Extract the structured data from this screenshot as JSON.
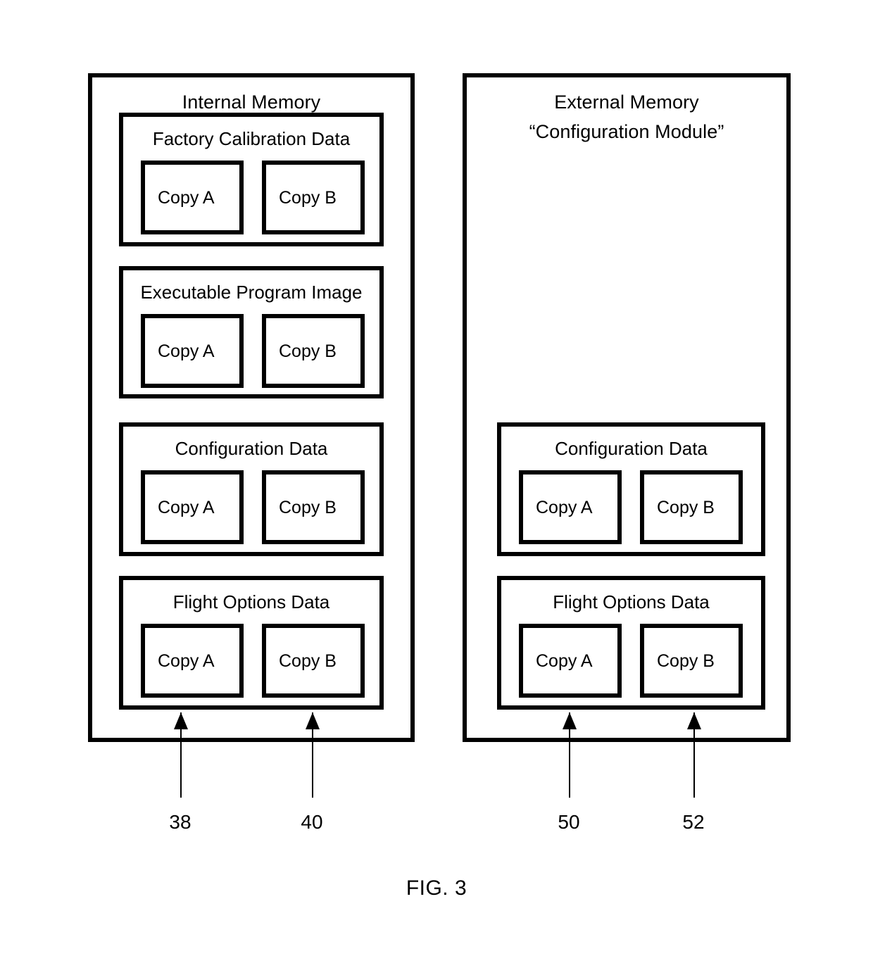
{
  "figure": {
    "caption": "FIG. 3"
  },
  "panels": [
    {
      "id": "internal-memory",
      "title": "Internal Memory",
      "subtitle": "",
      "sections": [
        {
          "id": "factory-calibration",
          "title": "Factory Calibration Data",
          "copies": [
            {
              "id": "copy-a",
              "label": "Copy A"
            },
            {
              "id": "copy-b",
              "label": "Copy B"
            }
          ]
        },
        {
          "id": "executable-program",
          "title": "Executable Program Image",
          "copies": [
            {
              "id": "copy-a",
              "label": "Copy A"
            },
            {
              "id": "copy-b",
              "label": "Copy B"
            }
          ]
        },
        {
          "id": "configuration-data",
          "title": "Configuration Data",
          "copies": [
            {
              "id": "copy-a",
              "label": "Copy A"
            },
            {
              "id": "copy-b",
              "label": "Copy B"
            }
          ]
        },
        {
          "id": "flight-options",
          "title": "Flight Options Data",
          "copies": [
            {
              "id": "copy-a",
              "label": "Copy A"
            },
            {
              "id": "copy-b",
              "label": "Copy B"
            }
          ]
        }
      ]
    },
    {
      "id": "external-memory",
      "title": "External Memory",
      "subtitle": "“Configuration Module”",
      "sections": [
        {
          "id": "configuration-data",
          "title": "Configuration Data",
          "copies": [
            {
              "id": "copy-a",
              "label": "Copy A"
            },
            {
              "id": "copy-b",
              "label": "Copy B"
            }
          ]
        },
        {
          "id": "flight-options",
          "title": "Flight Options Data",
          "copies": [
            {
              "id": "copy-a",
              "label": "Copy A"
            },
            {
              "id": "copy-b",
              "label": "Copy B"
            }
          ]
        }
      ]
    }
  ],
  "callouts": [
    {
      "id": "callout-38",
      "number": "38",
      "points_to": "internal-memory.flight-options.copy-a"
    },
    {
      "id": "callout-40",
      "number": "40",
      "points_to": "internal-memory.flight-options.copy-b"
    },
    {
      "id": "callout-50",
      "number": "50",
      "points_to": "external-memory.flight-options.copy-a"
    },
    {
      "id": "callout-52",
      "number": "52",
      "points_to": "external-memory.flight-options.copy-b"
    }
  ],
  "style": {
    "stroke_color": "#000000",
    "background_color": "#ffffff"
  }
}
